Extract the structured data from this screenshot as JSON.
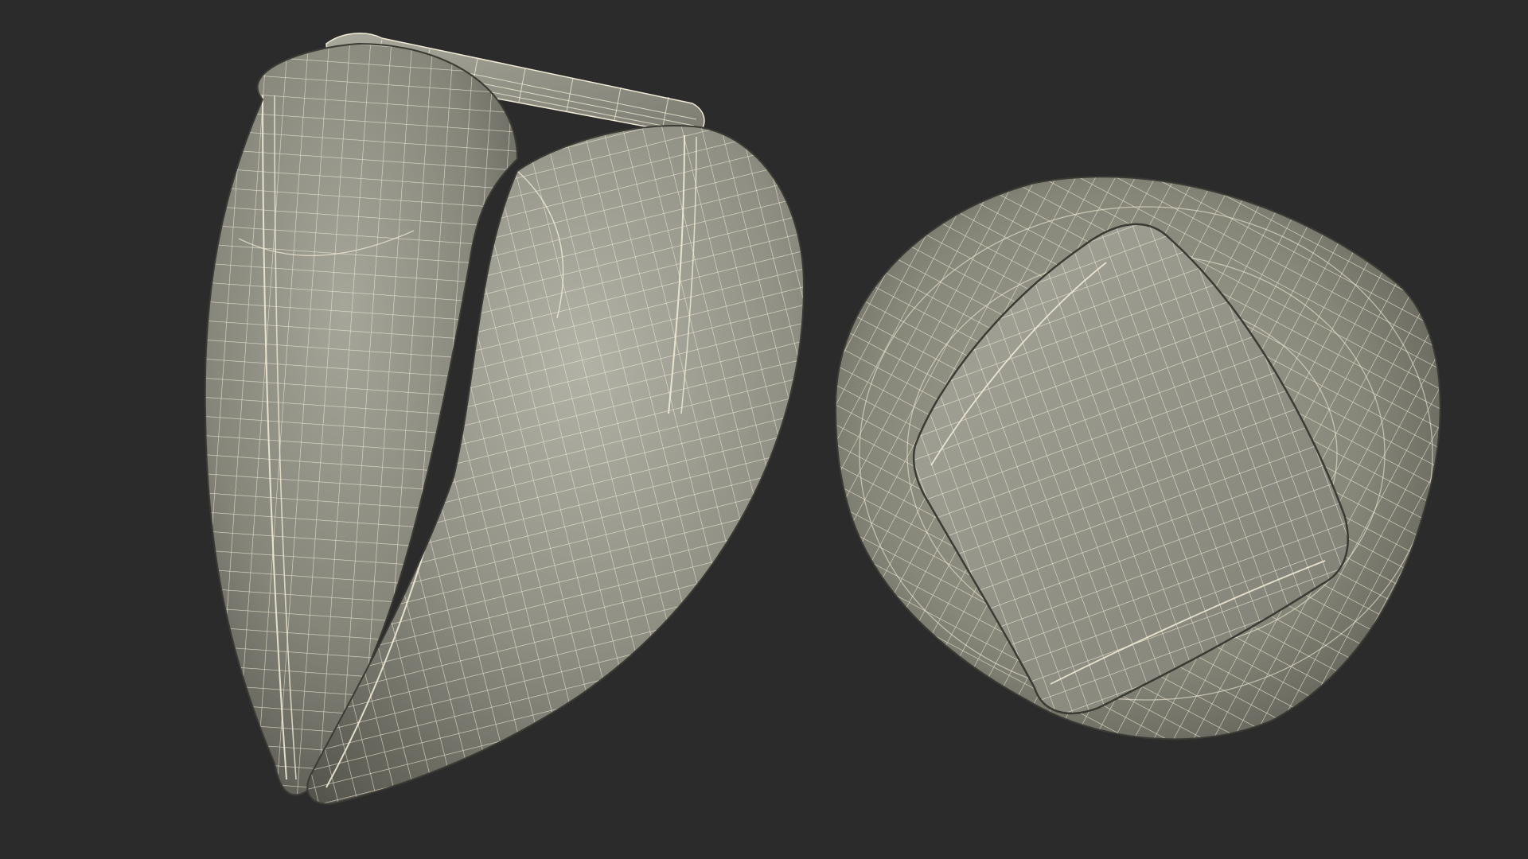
{
  "scene": {
    "background_color": "#2b2b2b",
    "wireframe_color": "#f1ead6",
    "surface_color": "#85857a",
    "shadow_color": "#4c4c45",
    "highlight_color": "#b7b6a9",
    "objects": [
      {
        "name": "folded-pillow-wireframe",
        "view": "side"
      },
      {
        "name": "rolled-pillow-wireframe",
        "view": "top"
      }
    ]
  }
}
